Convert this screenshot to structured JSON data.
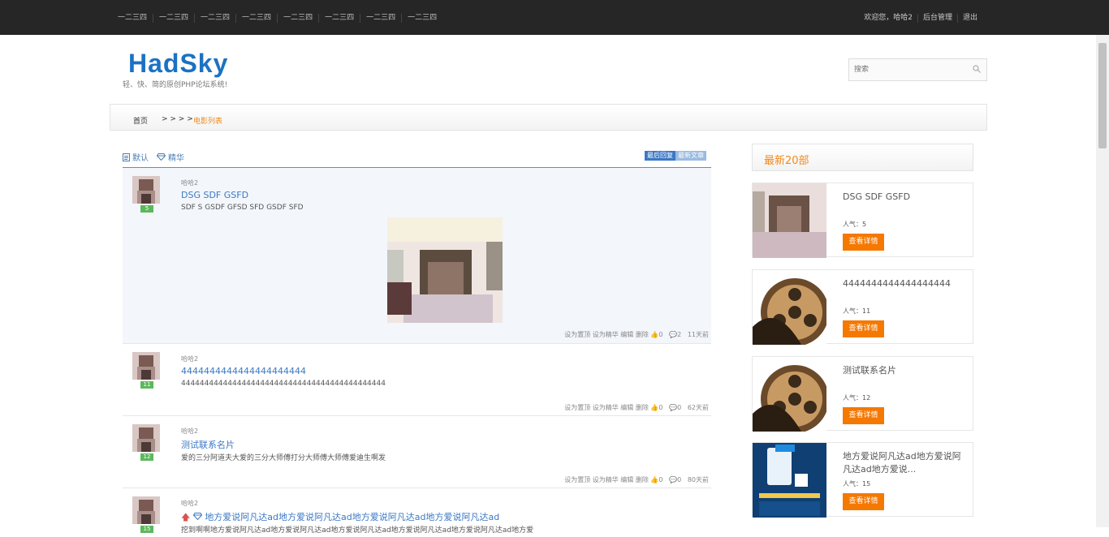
{
  "topbar": {
    "nav": [
      "一二三四",
      "一二三四",
      "一二三四",
      "一二三四",
      "一二三四",
      "一二三四",
      "一二三四",
      "一二三四"
    ],
    "welcome": "欢迎您，哈哈2",
    "admin": "后台管理",
    "logout": "退出"
  },
  "header": {
    "logo": "HadSky",
    "slogan": "轻、快、简的原创PHP论坛系统!",
    "search_placeholder": "搜索"
  },
  "breadcrumb": {
    "home": "首页",
    "sep": "> > > >",
    "current": "电影列表"
  },
  "tabs": {
    "default": "默认",
    "essence": "精华",
    "last_reply": "最后回复",
    "newest": "最新文章"
  },
  "posts": [
    {
      "user": "哈哈2",
      "badge": "5",
      "title": "DSG SDF GSFD",
      "body": "SDF S GSDF GFSD SFD GSDF SFD",
      "actions": "设为置顶 设为精华 编辑 删除",
      "likes": "0",
      "comments": "2",
      "time": "11天前"
    },
    {
      "user": "哈哈2",
      "badge": "11",
      "title": "4444444444444444444444",
      "body": "44444444444444444444444444444444444444444444",
      "actions": "设为置顶 设为精华 编辑 删除",
      "likes": "0",
      "comments": "0",
      "time": "62天前"
    },
    {
      "user": "哈哈2",
      "badge": "12",
      "title": "测试联系名片",
      "body": "爱的三分阿道夫大爱的三分大师傅打分大师傅大师傅爱迪生啊发",
      "actions": "设为置顶 设为精华 编辑 删除",
      "likes": "0",
      "comments": "0",
      "time": "80天前"
    },
    {
      "user": "哈哈2",
      "badge": "15",
      "title": "地方爱说阿凡达ad地方爱说阿凡达ad地方爱说阿凡达ad地方爱说阿凡达ad",
      "body": "挖到啊啊地方爱说阿凡达ad地方爱说阿凡达ad地方爱说阿凡达ad地方爱说阿凡达ad地方爱说阿凡达ad地方爱"
    }
  ],
  "sidebar": {
    "heading": "最新20部",
    "pop_label": "人气：",
    "btn": "查看详情",
    "items": [
      {
        "title": "DSG SDF GSFD",
        "pop": "5"
      },
      {
        "title": "4444444444444444444",
        "pop": "11"
      },
      {
        "title": "测试联系名片",
        "pop": "12"
      },
      {
        "title": "地方爱说阿凡达ad地方爱说阿凡达ad地方爱说...",
        "pop": "15"
      }
    ]
  },
  "colors": {
    "accent": "#3b78c4",
    "orange": "#f57800",
    "topbar": "#262626"
  }
}
